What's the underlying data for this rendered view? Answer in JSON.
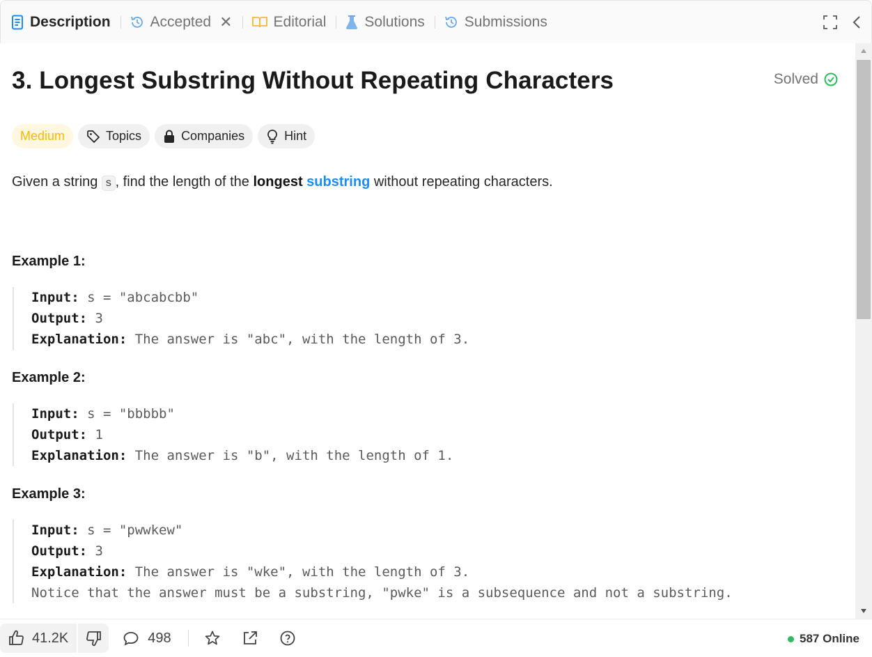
{
  "tabs": [
    {
      "label": "Description",
      "icon": "description-icon",
      "active": true
    },
    {
      "label": "Accepted",
      "icon": "history-icon",
      "closable": true
    },
    {
      "label": "Editorial",
      "icon": "book-icon"
    },
    {
      "label": "Solutions",
      "icon": "flask-icon"
    },
    {
      "label": "Submissions",
      "icon": "history-icon"
    }
  ],
  "problem": {
    "title": "3. Longest Substring Without Repeating Characters",
    "status": "Solved",
    "difficulty": "Medium",
    "chips": {
      "topics": "Topics",
      "companies": "Companies",
      "hint": "Hint"
    },
    "desc": {
      "pre": "Given a string ",
      "var": "s",
      "mid": ", find the length of the ",
      "bold": "longest",
      "link": "substring",
      "post": " without repeating characters."
    }
  },
  "examples": [
    {
      "title": "Example 1:",
      "input_label": "Input:",
      "input": " s = \"abcabcbb\"",
      "output_label": "Output:",
      "output": " 3",
      "explanation_label": "Explanation:",
      "explanation": " The answer is \"abc\", with the length of 3."
    },
    {
      "title": "Example 2:",
      "input_label": "Input:",
      "input": " s = \"bbbbb\"",
      "output_label": "Output:",
      "output": " 1",
      "explanation_label": "Explanation:",
      "explanation": " The answer is \"b\", with the length of 1."
    },
    {
      "title": "Example 3:",
      "input_label": "Input:",
      "input": " s = \"pwwkew\"",
      "output_label": "Output:",
      "output": " 3",
      "explanation_label": "Explanation:",
      "explanation": " The answer is \"wke\", with the length of 3.",
      "note": "Notice that the answer must be a substring, \"pwke\" is a subsequence and not a substring."
    }
  ],
  "footer": {
    "likes": "41.2K",
    "comments": "498",
    "online": "587 Online"
  },
  "colors": {
    "accent_blue": "#1a8cff",
    "medium": "#ffb800",
    "solved_green": "#2cbb5d"
  }
}
